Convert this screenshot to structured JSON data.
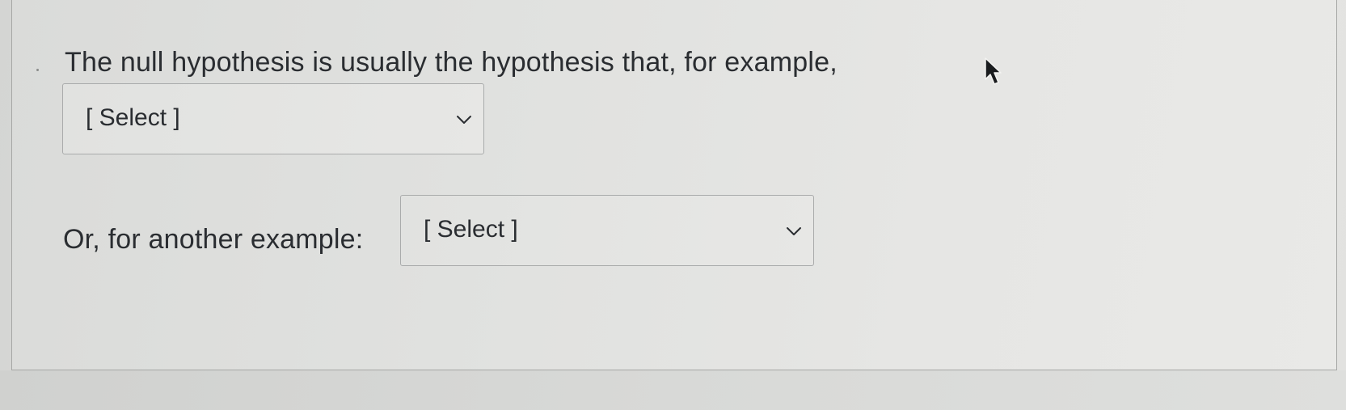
{
  "question": {
    "text": "The null hypothesis is usually the hypothesis that, for example,",
    "select_1": {
      "selected_value": "[ Select ]",
      "icon": "chevron-down-icon"
    },
    "second_label": "Or, for another example:",
    "select_2": {
      "selected_value": "[ Select ]",
      "icon": "chevron-down-icon"
    }
  },
  "cursor": {
    "icon": "mouse-pointer-icon"
  },
  "colors": {
    "background": "#e2e2e0",
    "text": "#2a2d31",
    "border": "#a9abab"
  }
}
